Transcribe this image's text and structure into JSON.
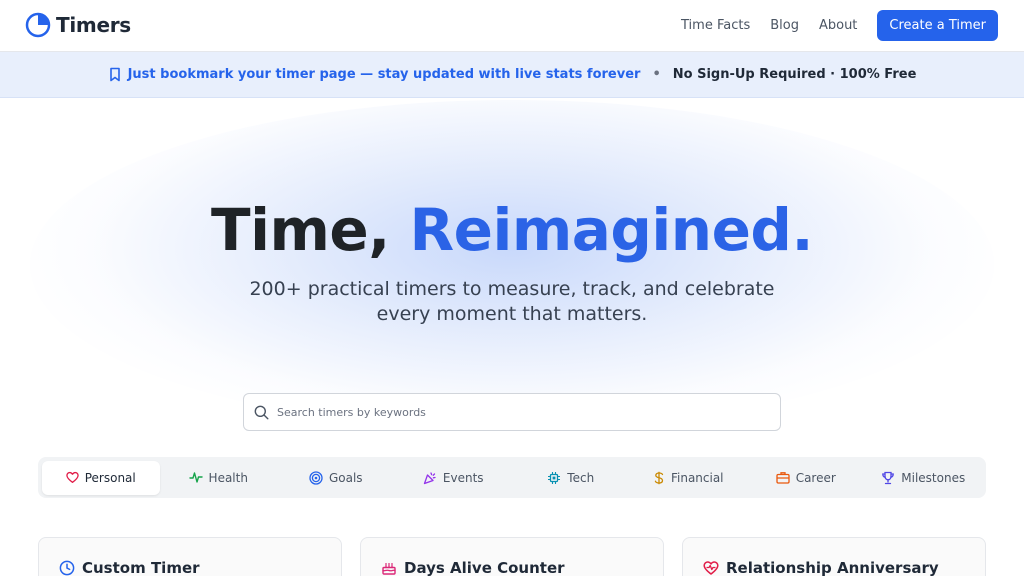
{
  "header": {
    "logo_text": "Timers",
    "nav": [
      "Time Facts",
      "Blog",
      "About"
    ],
    "cta_label": "Create a Timer"
  },
  "banner": {
    "left_text": "Just bookmark your timer page — stay updated with live stats forever",
    "separator": "•",
    "right_text": "No Sign-Up Required · 100% Free"
  },
  "hero": {
    "title_plain": "Time, ",
    "title_accent": "Reimagined.",
    "subtitle_line1": "200+ practical timers to measure, track, and celebrate",
    "subtitle_line2": "every moment that matters."
  },
  "search": {
    "placeholder": "Search timers by keywords",
    "value": ""
  },
  "tabs": [
    {
      "label": "Personal",
      "icon": "heart-icon",
      "color": "#e11d48",
      "active": true
    },
    {
      "label": "Health",
      "icon": "activity-icon",
      "color": "#16a34a",
      "active": false
    },
    {
      "label": "Goals",
      "icon": "target-icon",
      "color": "#2563eb",
      "active": false
    },
    {
      "label": "Events",
      "icon": "party-icon",
      "color": "#9333ea",
      "active": false
    },
    {
      "label": "Tech",
      "icon": "chip-icon",
      "color": "#0891b2",
      "active": false
    },
    {
      "label": "Financial",
      "icon": "dollar-icon",
      "color": "#ca8a04",
      "active": false
    },
    {
      "label": "Career",
      "icon": "briefcase-icon",
      "color": "#ea580c",
      "active": false
    },
    {
      "label": "Milestones",
      "icon": "trophy-icon",
      "color": "#4f46e5",
      "active": false
    }
  ],
  "cards": [
    {
      "title": "Custom Timer",
      "icon": "clock-icon",
      "color": "#2563eb"
    },
    {
      "title": "Days Alive Counter",
      "icon": "cake-icon",
      "color": "#db2777"
    },
    {
      "title": "Relationship Anniversary",
      "icon": "heart-pulse-icon",
      "color": "#e11d48"
    }
  ],
  "colors": {
    "brand": "#2563eb",
    "banner_bg": "#e8effc",
    "title_text": "#1f2327"
  }
}
